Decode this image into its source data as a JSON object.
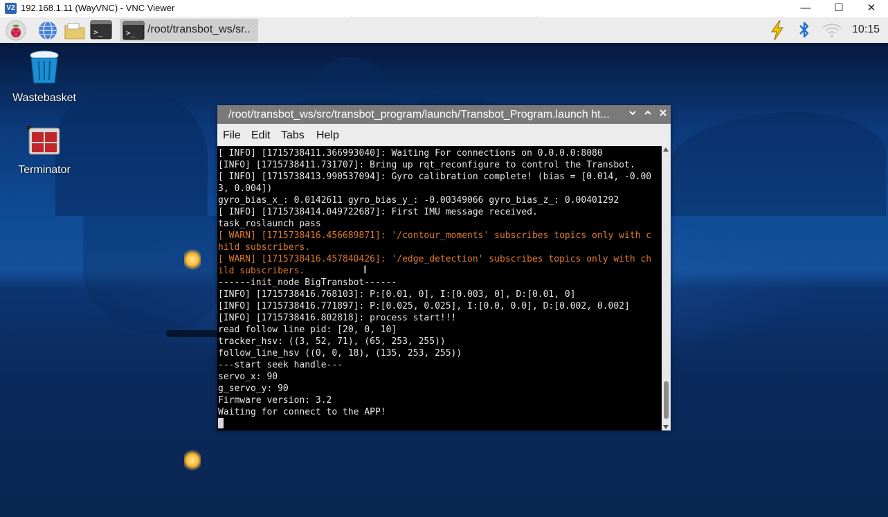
{
  "vnc": {
    "logo": "V2",
    "title": "192.168.1.11 (WayVNC) - VNC Viewer",
    "minimize": "—",
    "maximize": "☐",
    "close": "✕"
  },
  "taskbar": {
    "terminal_glyph": ">_",
    "task_label": "/root/transbot_ws/sr..",
    "clock": "10:15",
    "icons": [
      "raspberry-menu-icon",
      "web-browser-icon",
      "file-manager-icon",
      "terminal-icon",
      "power-icon",
      "bluetooth-icon",
      "wifi-icon"
    ]
  },
  "desktop": {
    "icons": [
      {
        "label": "Wastebasket",
        "icon": "trash-icon"
      },
      {
        "label": "Terminator",
        "icon": "terminator-icon"
      }
    ]
  },
  "terminal": {
    "title": "/root/transbot_ws/src/transbot_program/launch/Transbot_Program.launch ht...",
    "menu": [
      "File",
      "Edit",
      "Tabs",
      "Help"
    ],
    "lines": [
      {
        "text": "[ INFO] [1715738411.366993040]: Waiting For connections on 0.0.0.0:8080",
        "warn": false
      },
      {
        "text": "[INFO] [1715738411.731707]: Bring up rqt_reconfigure to control the Transbot.",
        "warn": false
      },
      {
        "text": "[ INFO] [1715738413.990537094]: Gyro calibration complete! (bias = [0.014, -0.00",
        "warn": false
      },
      {
        "text": "3, 0.004])",
        "warn": false
      },
      {
        "text": "gyro_bias_x_: 0.0142611 gyro_bias_y_: -0.00349066 gyro_bias_z_: 0.00401292",
        "warn": false
      },
      {
        "text": "[ INFO] [1715738414.049722687]: First IMU message received.",
        "warn": false
      },
      {
        "text": "task_roslaunch pass",
        "warn": false
      },
      {
        "text": "[ WARN] [1715738416.456689871]: '/contour_moments' subscribes topics only with c",
        "warn": true
      },
      {
        "text": "hild subscribers.",
        "warn": true
      },
      {
        "text": "[ WARN] [1715738416.457840426]: '/edge_detection' subscribes topics only with ch",
        "warn": true
      },
      {
        "text": "ild subscribers.",
        "warn": true
      },
      {
        "text": "------init_node BigTransbot------",
        "warn": false
      },
      {
        "text": "[INFO] [1715738416.768103]: P:[0.01, 0], I:[0.003, 0], D:[0.01, 0]",
        "warn": false
      },
      {
        "text": "[INFO] [1715738416.771897]: P:[0.025, 0.025], I:[0.0, 0.0], D:[0.002, 0.002]",
        "warn": false
      },
      {
        "text": "[INFO] [1715738416.802818]: process start!!!",
        "warn": false
      },
      {
        "text": "read follow line pid: [20, 0, 10]",
        "warn": false
      },
      {
        "text": "tracker_hsv: ((3, 52, 71), (65, 253, 255))",
        "warn": false
      },
      {
        "text": "follow_line_hsv ((0, 0, 18), (135, 253, 255))",
        "warn": false
      },
      {
        "text": "---start seek handle---",
        "warn": false
      },
      {
        "text": "servo_x: 90",
        "warn": false
      },
      {
        "text": "g_servo_y: 90",
        "warn": false
      },
      {
        "text": "Firmware version: 3.2",
        "warn": false
      },
      {
        "text": "Waiting for connect to the APP!",
        "warn": false
      }
    ]
  },
  "colors": {
    "warn": "#e07a2a",
    "terminal_bg": "#000000",
    "titlebar": "#7a7a7a"
  }
}
